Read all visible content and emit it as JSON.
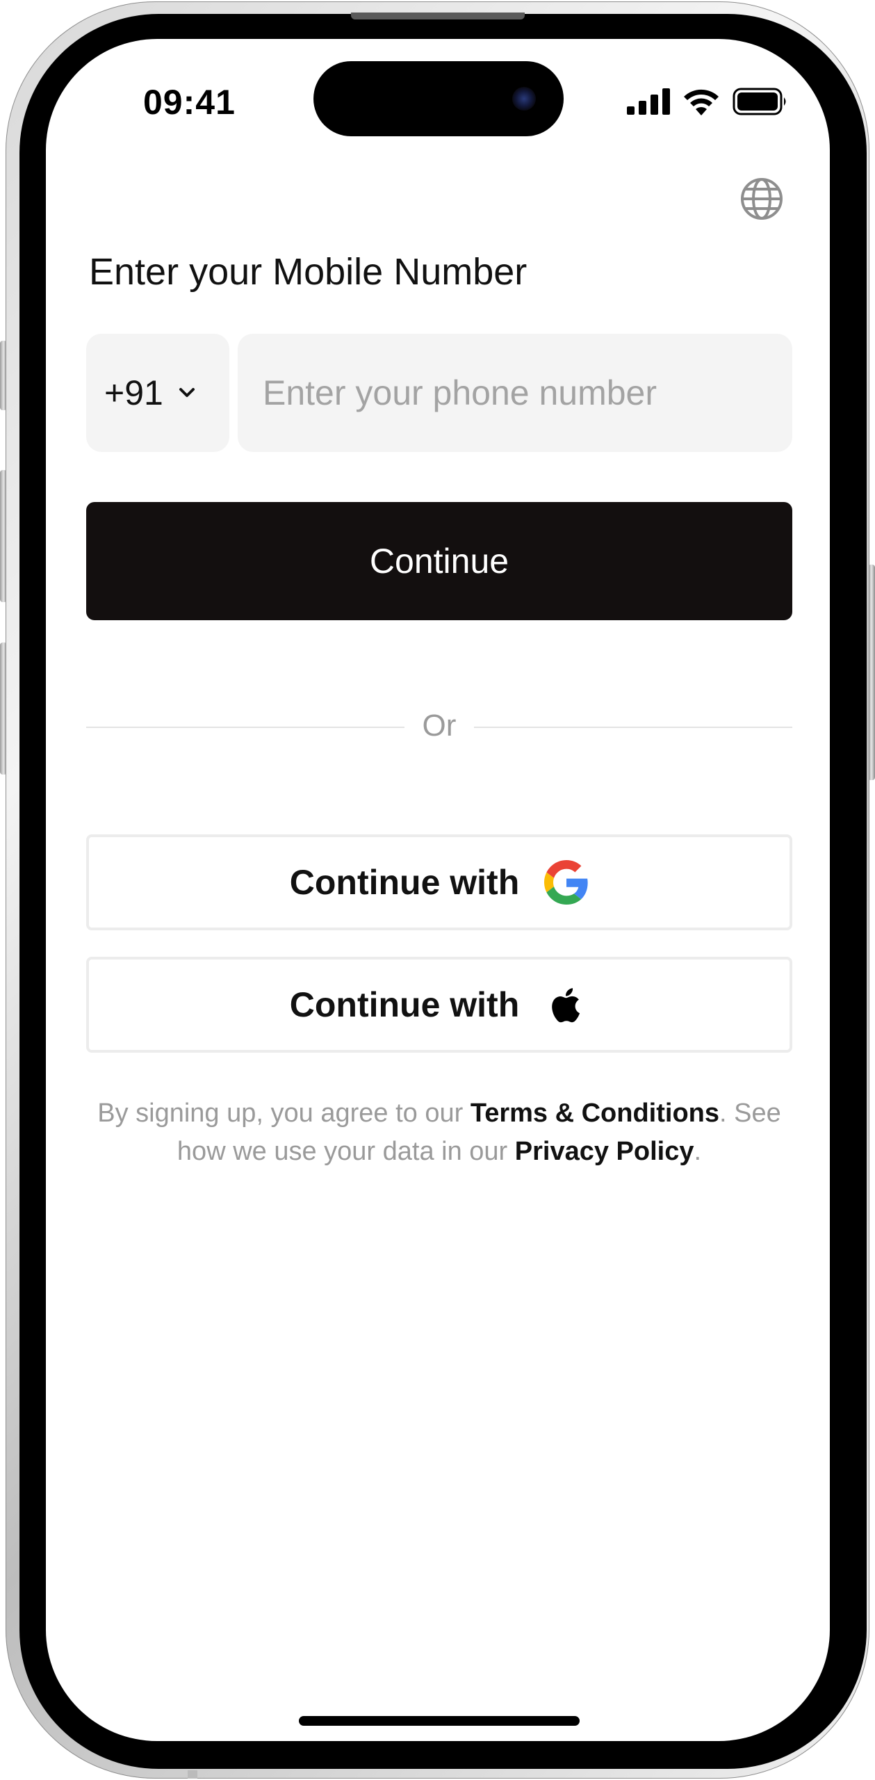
{
  "status_bar": {
    "time": "09:41"
  },
  "header": {
    "language_icon": "globe-icon"
  },
  "form": {
    "title": "Enter your Mobile Number",
    "country_code": "+91",
    "phone_placeholder": "Enter your phone number",
    "continue_label": "Continue"
  },
  "divider": {
    "label": "Or"
  },
  "social": {
    "google_label": "Continue with",
    "google_icon": "google-icon",
    "apple_label": "Continue with",
    "apple_icon": "apple-icon"
  },
  "legal": {
    "prefix": "By signing up, you agree to our ",
    "terms_link": "Terms & Conditions",
    "middle": ". See how we use your data in our ",
    "privacy_link": "Privacy Policy",
    "suffix": "."
  },
  "colors": {
    "primary_button": "#130f0f",
    "field_background": "#f4f4f4",
    "muted_text": "#9a9a9a",
    "google_blue": "#4285F4",
    "google_red": "#EA4335",
    "google_yellow": "#FBBC05",
    "google_green": "#34A853"
  }
}
